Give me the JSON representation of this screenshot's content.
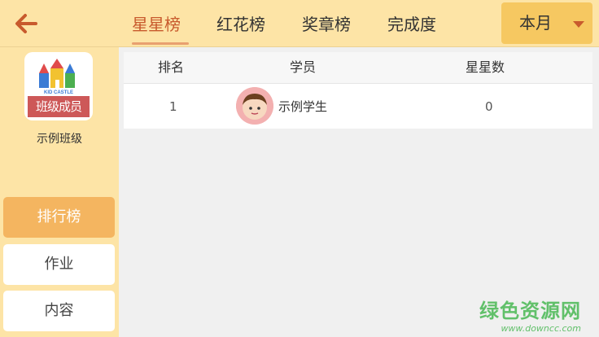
{
  "sidebar": {
    "logo_text": "班级成员",
    "logo_small": "KID CASTLE",
    "class_name": "示例班级",
    "nav": [
      {
        "label": "排行榜"
      },
      {
        "label": "作业"
      },
      {
        "label": "内容"
      }
    ]
  },
  "tabs": [
    {
      "label": "星星榜"
    },
    {
      "label": "红花榜"
    },
    {
      "label": "奖章榜"
    },
    {
      "label": "完成度"
    }
  ],
  "month_select": {
    "value": "本月"
  },
  "table": {
    "headers": [
      "排名",
      "学员",
      "星星数"
    ],
    "rows": [
      {
        "rank": "1",
        "name": "示例学生",
        "stars": "0"
      }
    ]
  },
  "watermark": {
    "title": "绿色资源网",
    "url": "www.downcc.com"
  }
}
